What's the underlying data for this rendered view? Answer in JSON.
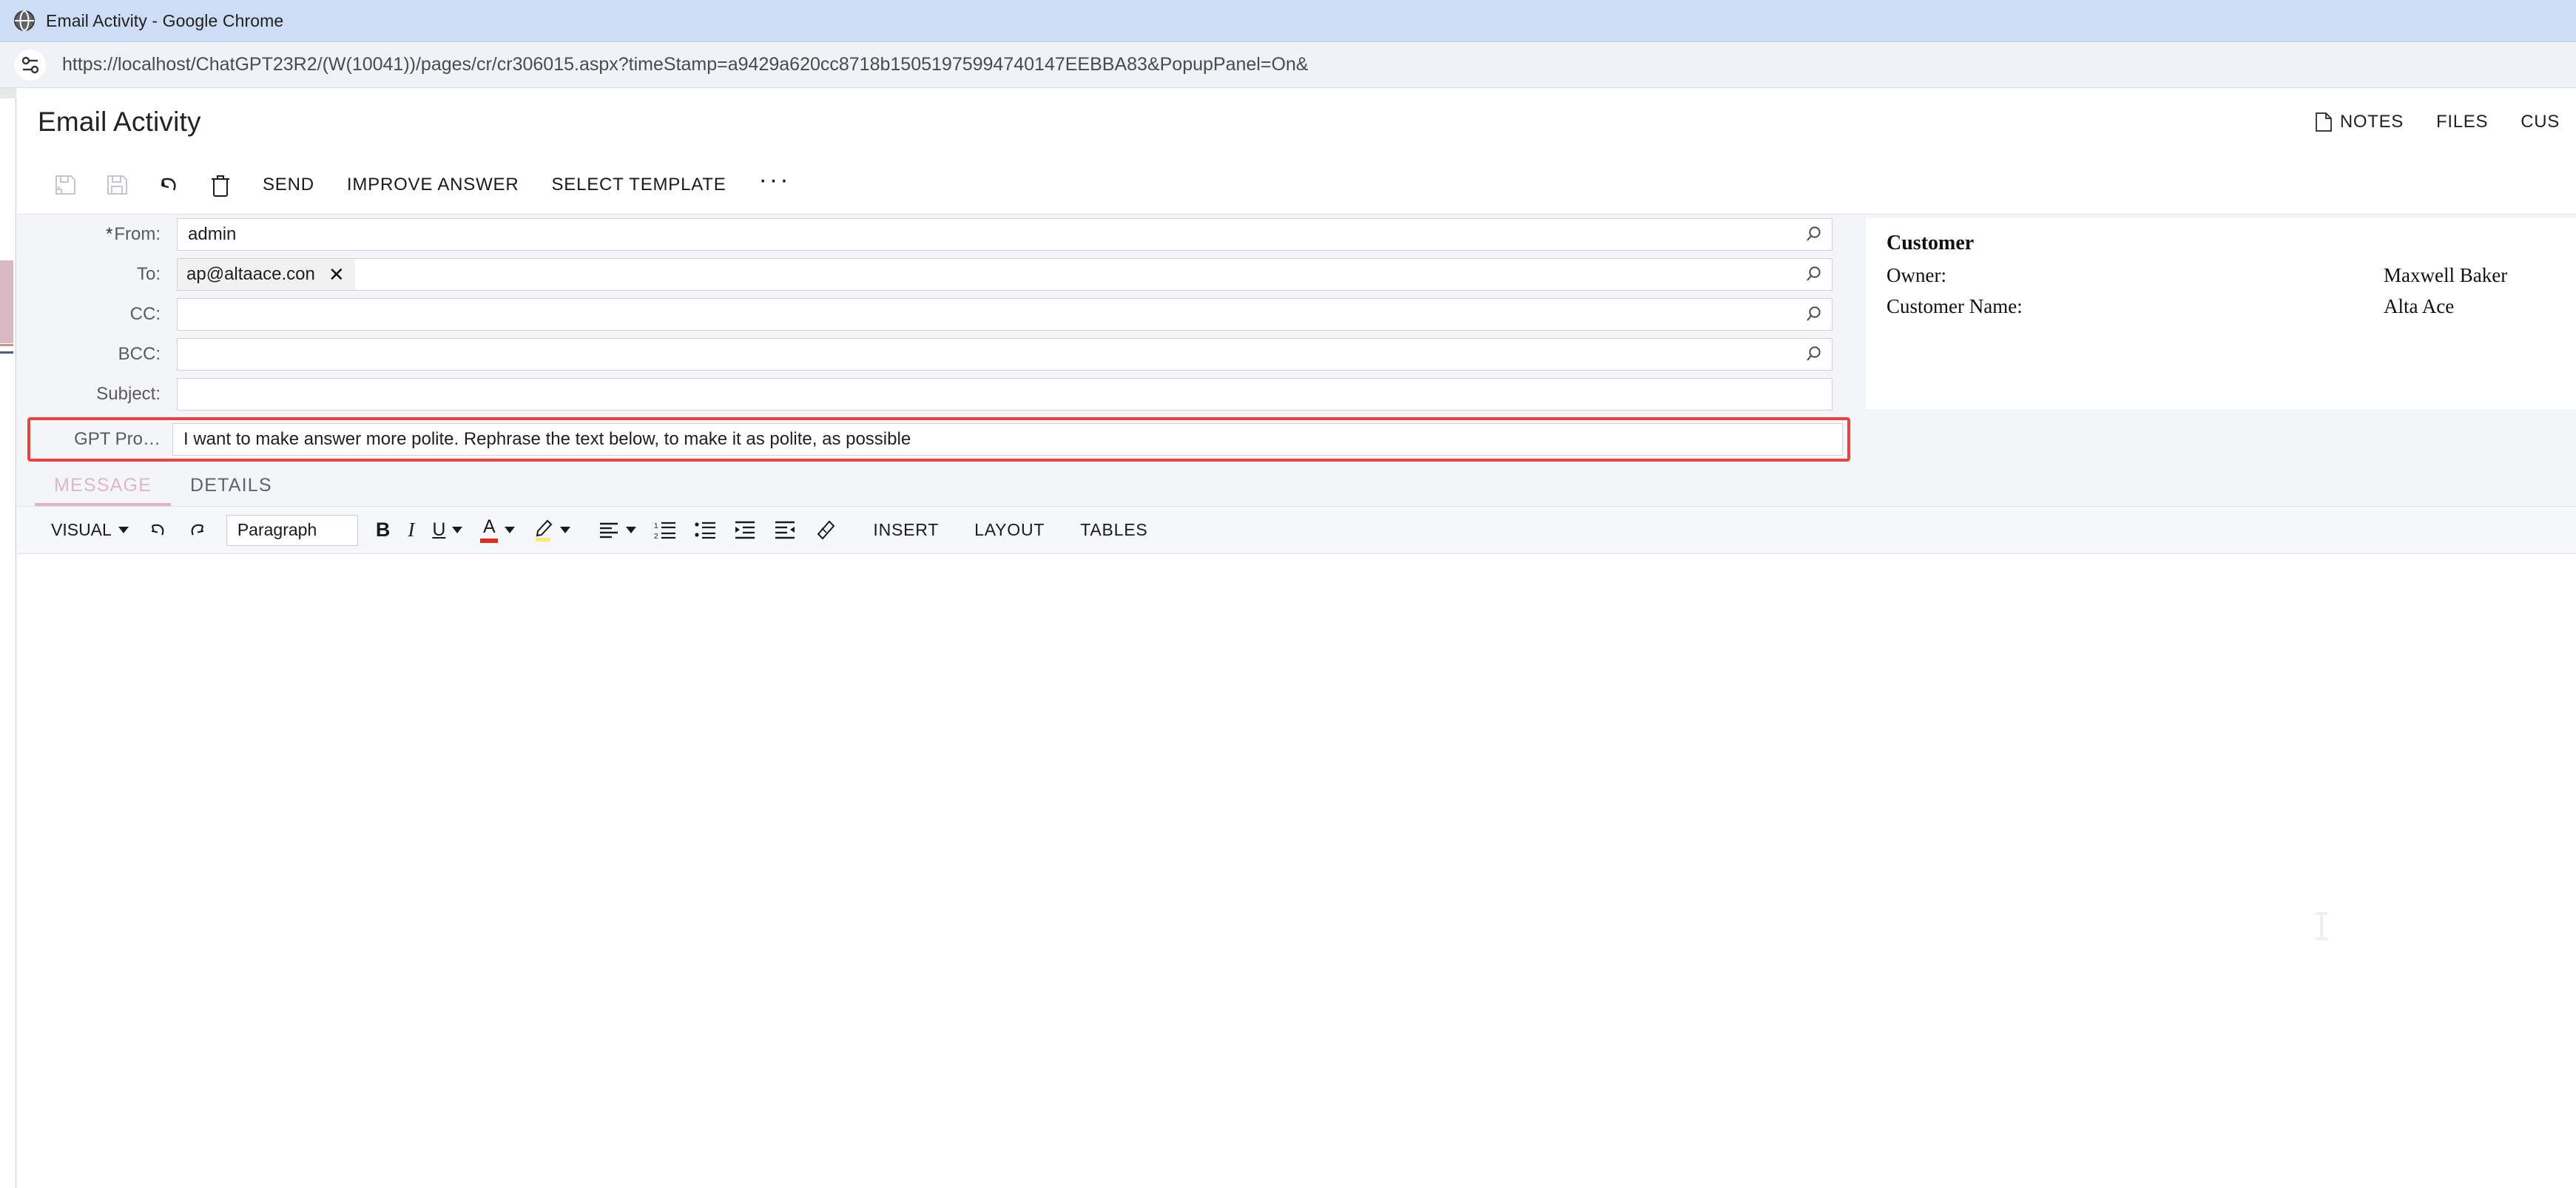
{
  "browser": {
    "window_title": "Email Activity - Google Chrome",
    "favicon": "globe-icon",
    "site_info_icon": "site-settings-icon",
    "url": "https://localhost/ChatGPT23R2/(W(10041))/pages/cr/cr306015.aspx?timeStamp=a9429a620cc8718b15051975994740147EEBBA83&PopupPanel=On&"
  },
  "page": {
    "title": "Email Activity",
    "header_links": [
      {
        "label": "NOTES",
        "icon": "note-page-icon"
      },
      {
        "label": "FILES",
        "icon": ""
      },
      {
        "label": "CUS",
        "icon": ""
      }
    ]
  },
  "toolbar": {
    "icons": [
      {
        "name": "save-and-close-icon",
        "state": "disabled"
      },
      {
        "name": "save-icon",
        "state": "disabled"
      },
      {
        "name": "undo-icon",
        "state": "enabled"
      },
      {
        "name": "delete-trash-icon",
        "state": "enabled"
      }
    ],
    "buttons": [
      {
        "label": "SEND"
      },
      {
        "label": "IMPROVE ANSWER"
      },
      {
        "label": "SELECT TEMPLATE"
      }
    ],
    "more_label": "···"
  },
  "form": {
    "from": {
      "label": "From:",
      "required_marker": "*",
      "value": "admin",
      "placeholder": "",
      "selector_icon": "magnifier-icon"
    },
    "to": {
      "label": "To:",
      "chip": "ap@altaace.con",
      "chip_remove": "✕",
      "placeholder": "",
      "selector_icon": "magnifier-icon"
    },
    "cc": {
      "label": "CC:",
      "value": "",
      "placeholder": "",
      "selector_icon": "magnifier-icon"
    },
    "bcc": {
      "label": "BCC:",
      "value": "",
      "placeholder": "",
      "selector_icon": "magnifier-icon"
    },
    "subject": {
      "label": "Subject:",
      "value": "",
      "placeholder": ""
    },
    "gpt_prompt": {
      "label": "GPT Pro…",
      "value": "I want to make answer more polite. Rephrase the text below, to make it as polite, as possible",
      "placeholder": "",
      "highlight_color": "#e8463c"
    }
  },
  "customer_card": {
    "title": "Customer",
    "rows": [
      {
        "key": "Owner:",
        "value": "Maxwell Baker"
      },
      {
        "key": "Customer Name:",
        "value": "Alta Ace"
      }
    ]
  },
  "tabs": [
    {
      "label": "MESSAGE",
      "active": true
    },
    {
      "label": "DETAILS",
      "active": false
    }
  ],
  "editor": {
    "mode_label": "VISUAL",
    "undo_icon": "undo-icon",
    "redo_icon": "redo-icon",
    "block_format": "Paragraph",
    "bold_label": "B",
    "italic_label": "I",
    "underline_label": "U",
    "font_color_label": "A",
    "highlight_icon": "highlighter-pen-icon",
    "align_icon": "align-left-icon",
    "ordered_list_icon": "numbered-list-icon",
    "unordered_list_icon": "bulleted-list-icon",
    "indent_icon": "increase-indent-icon",
    "outdent_icon": "decrease-indent-icon",
    "clear_format_icon": "eraser-icon",
    "menus": [
      {
        "label": "INSERT"
      },
      {
        "label": "LAYOUT"
      },
      {
        "label": "TABLES"
      }
    ],
    "content": ""
  },
  "colors": {
    "accent_red": "#e8463c",
    "tab_active": "#e0b5c4",
    "font_color_swatch": "#e12a22",
    "highlight_swatch": "#ffe95c",
    "chrome_titlebar": "#ccddf5"
  }
}
